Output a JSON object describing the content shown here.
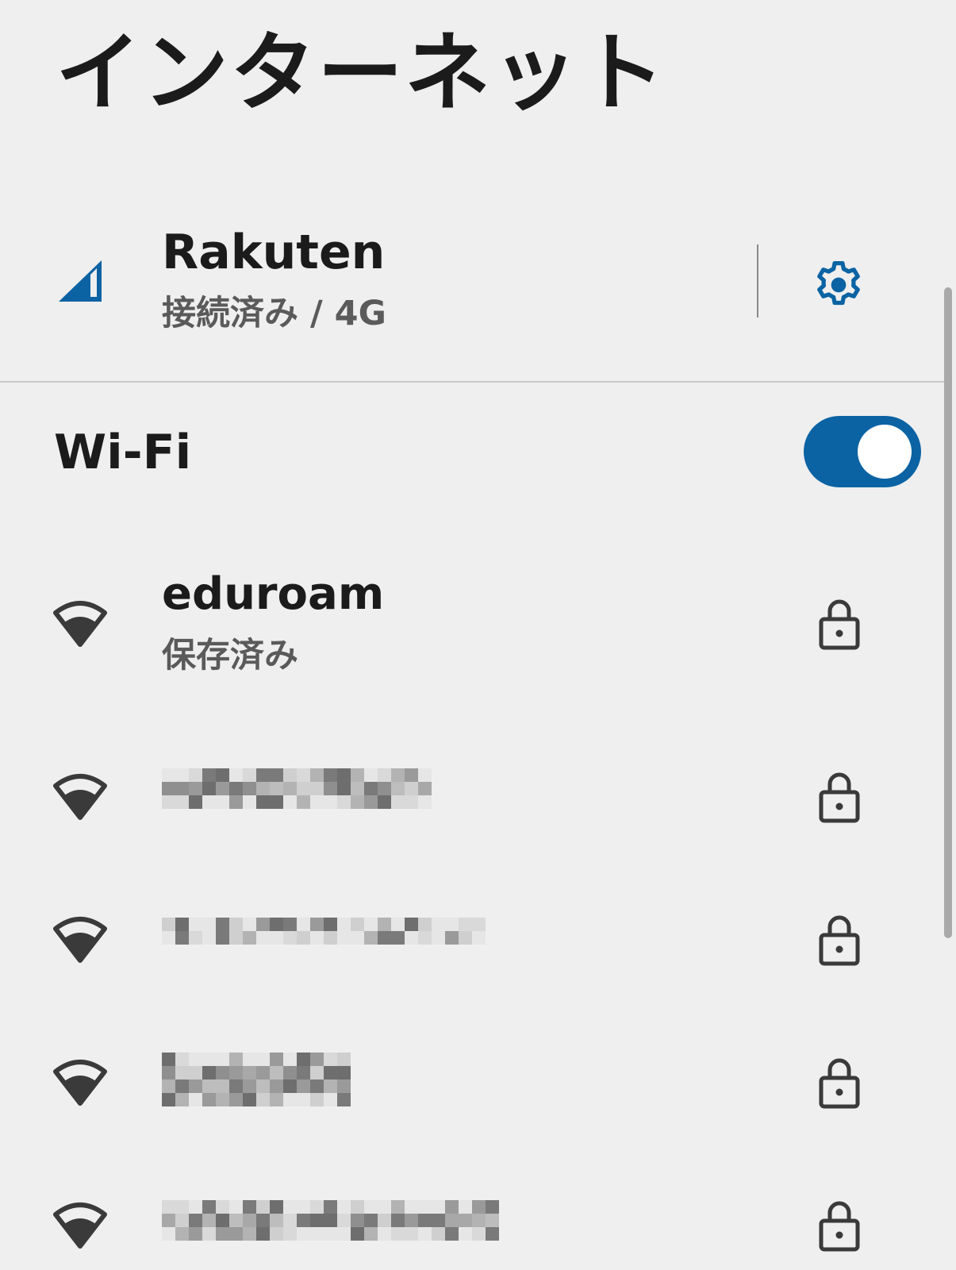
{
  "title": "インターネット",
  "mobile": {
    "carrier": "Rakuten",
    "status": "接続済み / 4G",
    "icon": "cell-signal-icon",
    "settings_icon": "gear-icon",
    "accent": "#0b63a3"
  },
  "wifi": {
    "label": "Wi-Fi",
    "enabled": true,
    "toggle_color": "#0b63a3"
  },
  "networks": [
    {
      "name": "eduroam",
      "status": "保存済み",
      "secured": true,
      "redacted": false
    },
    {
      "name": "",
      "status": "",
      "secured": true,
      "redacted": true
    },
    {
      "name": "",
      "status": "",
      "secured": true,
      "redacted": true
    },
    {
      "name": "",
      "status": "",
      "secured": true,
      "redacted": true
    },
    {
      "name": "",
      "status": "",
      "secured": true,
      "redacted": true
    }
  ]
}
